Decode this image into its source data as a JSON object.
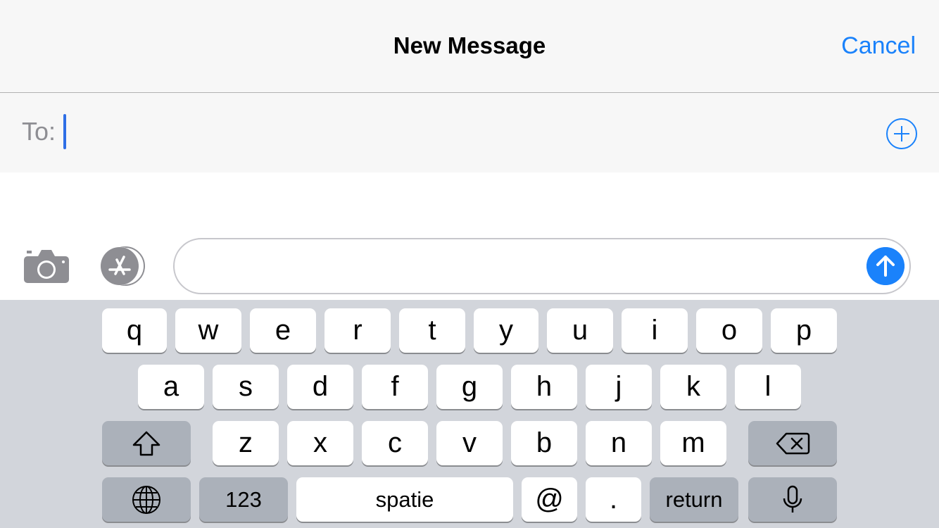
{
  "header": {
    "title": "New Message",
    "cancel_label": "Cancel"
  },
  "recipient": {
    "label": "To:",
    "value": ""
  },
  "composer": {
    "message_value": ""
  },
  "keyboard": {
    "row1": [
      "q",
      "w",
      "e",
      "r",
      "t",
      "y",
      "u",
      "i",
      "o",
      "p"
    ],
    "row2": [
      "a",
      "s",
      "d",
      "f",
      "g",
      "h",
      "j",
      "k",
      "l"
    ],
    "row3": [
      "z",
      "x",
      "c",
      "v",
      "b",
      "n",
      "m"
    ],
    "numbers_label": "123",
    "space_label": "spatie",
    "at_label": "@",
    "dot_label": ".",
    "return_label": "return"
  },
  "colors": {
    "accent": "#1a82fb",
    "keyboard_bg": "#d2d5db",
    "dark_key": "#abb1ba",
    "caret": "#2f6fe6"
  },
  "icons": [
    "plus-circle-icon",
    "camera-icon",
    "app-store-icon",
    "send-arrow-icon",
    "shift-icon",
    "delete-icon",
    "globe-icon",
    "microphone-icon"
  ]
}
